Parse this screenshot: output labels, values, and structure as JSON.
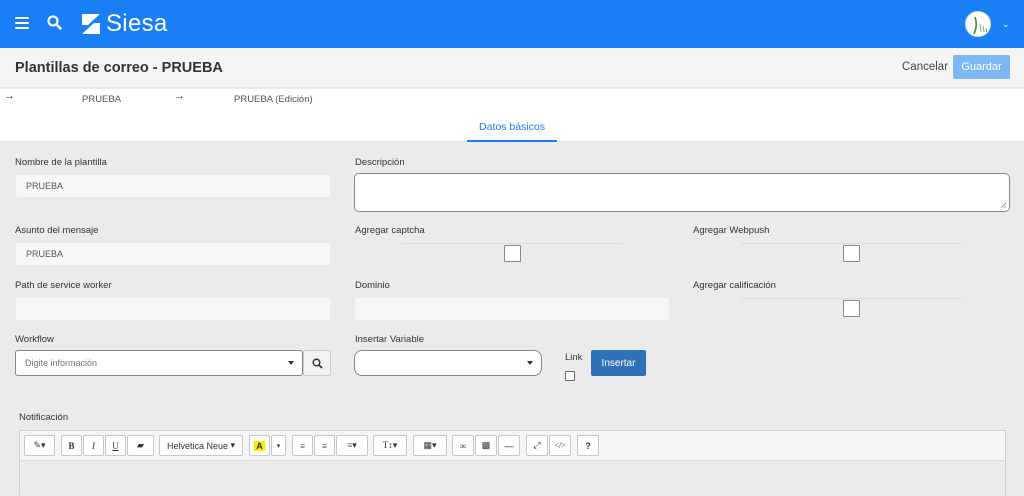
{
  "app": {
    "name": "Siesa"
  },
  "page": {
    "title": "Plantillas de correo - PRUEBA",
    "cancel_label": "Cancelar",
    "save_label": "Guardar"
  },
  "breadcrumb": {
    "items": [
      "PRUEBA",
      "PRUEBA (Edición)"
    ]
  },
  "tabs": [
    {
      "label": "Datos básicos",
      "active": true
    }
  ],
  "form": {
    "nombre": {
      "label": "Nombre de la plantilla",
      "value": "PRUEBA"
    },
    "descripcion": {
      "label": "Descripción",
      "value": ""
    },
    "asunto": {
      "label": "Asunto del mensaje",
      "value": "PRUEBA"
    },
    "captcha": {
      "label": "Agregar captcha",
      "checked": false
    },
    "webpush": {
      "label": "Agregar Webpush",
      "checked": false
    },
    "path": {
      "label": "Path de service worker",
      "value": ""
    },
    "dominio": {
      "label": "Dominio",
      "value": ""
    },
    "calificacion": {
      "label": "Agregar calificación",
      "checked": false
    },
    "workflow": {
      "label": "Workflow",
      "placeholder": "Digite información"
    },
    "variable": {
      "label": "Insertar Variable",
      "value": ""
    },
    "link": {
      "label": "Link",
      "checked": false
    },
    "insert_label": "Insertar",
    "notificacion": {
      "label": "Notificación"
    }
  },
  "editor": {
    "font_name": "Helvetica Neue"
  },
  "colors": {
    "brand": "#1a7ff5",
    "primary_button": "#2f72b8",
    "save_button": "#7db7f3"
  }
}
